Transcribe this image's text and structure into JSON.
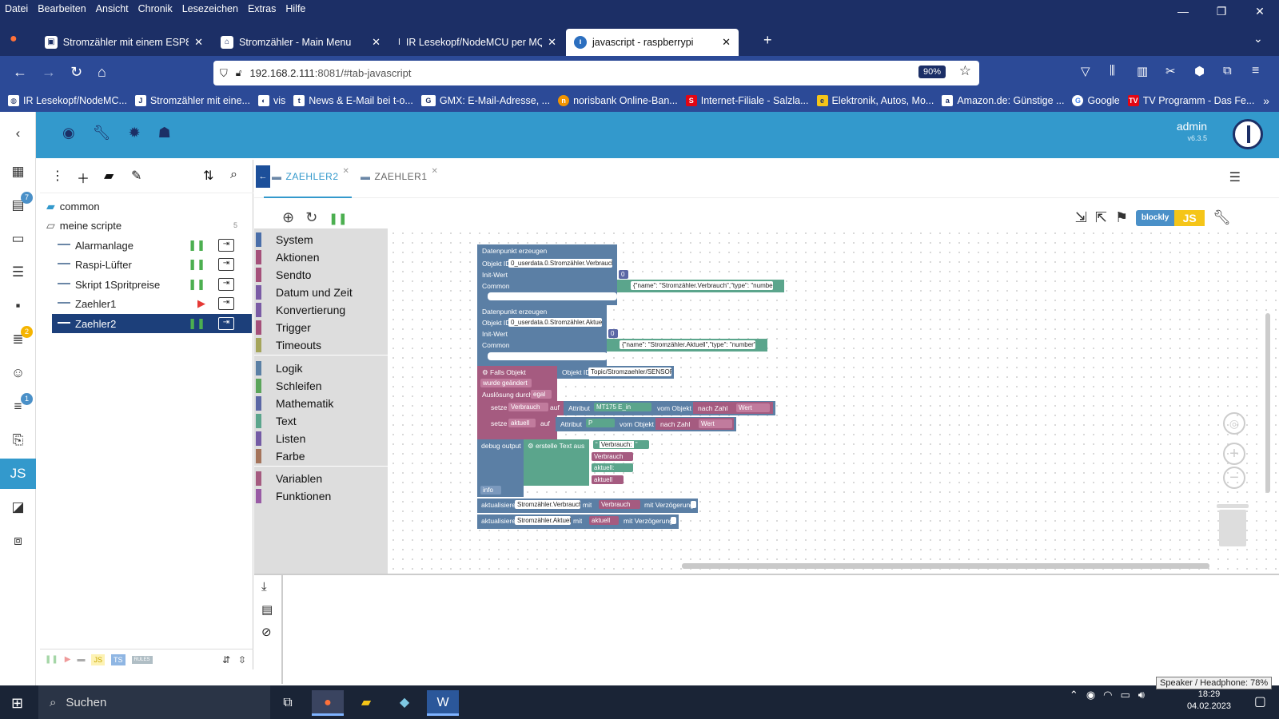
{
  "menubar": [
    "Datei",
    "Bearbeiten",
    "Ansicht",
    "Chronik",
    "Lesezeichen",
    "Extras",
    "Hilfe"
  ],
  "window_controls": [
    "—",
    "❐",
    "✕"
  ],
  "tabs": [
    {
      "title": "Stromzähler mit einem ESP8266"
    },
    {
      "title": "Stromzähler - Main Menu"
    },
    {
      "title": "IR Lesekopf/NodeMCU per MQTT"
    },
    {
      "title": "javascript - raspberrypi"
    }
  ],
  "nav": {
    "url_host": "192.168.2.111",
    "url_rest": ":8081/#tab-javascript",
    "zoom": "90%"
  },
  "bookmarks": [
    "IR Lesekopf/NodeMC...",
    "Stromzähler mit eine...",
    "vis",
    "News & E-Mail bei t-o...",
    "GMX: E-Mail-Adresse, ...",
    "norisbank Online-Ban...",
    "Internet-Filiale - Salzla...",
    "Elektronik, Autos, Mo...",
    "Amazon.de: Günstige ...",
    "Google",
    "TV Programm - Das Fe..."
  ],
  "rail_badges": {
    "hosts": "7",
    "logs": "2",
    "instances": "1"
  },
  "user": {
    "name": "admin",
    "version": "v6.3.5"
  },
  "tree": {
    "folders": [
      {
        "name": "common"
      },
      {
        "name": "meine scripte",
        "count": "5"
      }
    ],
    "scripts": [
      {
        "name": "Alarmanlage"
      },
      {
        "name": "Raspi-Lüfter"
      },
      {
        "name": "Skript 1Spritpreise"
      },
      {
        "name": "Zaehler1"
      },
      {
        "name": "Zaehler2"
      }
    ],
    "footer_tags": [
      "JS",
      "TS",
      "RULES"
    ]
  },
  "editor_tabs": [
    "ZAEHLER2",
    "ZAEHLER1"
  ],
  "blockly_toggle": {
    "left": "blockly",
    "right": "JS"
  },
  "colors": {
    "header": "#3399cc",
    "browser": "#1c2f66",
    "selected": "#1c3f7a"
  },
  "categories": [
    {
      "name": "System",
      "color": "#4a6ea9"
    },
    {
      "name": "Aktionen",
      "color": "#a5507a"
    },
    {
      "name": "Sendto",
      "color": "#a5507a"
    },
    {
      "name": "Datum und Zeit",
      "color": "#7a5ba5"
    },
    {
      "name": "Konvertierung",
      "color": "#7a5ba5"
    },
    {
      "name": "Trigger",
      "color": "#a5507a"
    },
    {
      "name": "Timeouts",
      "color": "#a5a55b"
    },
    {
      "name": "Logik",
      "color": "#5b80a5"
    },
    {
      "name": "Schleifen",
      "color": "#5ba55b"
    },
    {
      "name": "Mathematik",
      "color": "#5b67a5"
    },
    {
      "name": "Text",
      "color": "#5ba58c"
    },
    {
      "name": "Listen",
      "color": "#745ba5"
    },
    {
      "name": "Farbe",
      "color": "#a5745b"
    },
    {
      "name": "Variablen",
      "color": "#a55b80"
    },
    {
      "name": "Funktionen",
      "color": "#995ba5"
    }
  ],
  "blocks": {
    "dp1": {
      "title": "Datenpunkt erzeugen",
      "objid_label": "Objekt ID",
      "objid": "0_userdata.0.Stromzähler.Verbrauch",
      "init_label": "Init-Wert",
      "init": "0",
      "common_label": "Common",
      "common": "{\"name\": \"Stromzähler.Verbrauch\",\"type\": \"number..."
    },
    "dp2": {
      "title": "Datenpunkt erzeugen",
      "objid_label": "Objekt ID",
      "objid": "0_userdata.0.Stromzähler.Aktuell",
      "init_label": "Init-Wert",
      "init": "0",
      "common_label": "Common",
      "common": "{\"name\": \"Stromzähler.Aktuell\",\"type\": \"number\",..."
    },
    "trigger": {
      "title": "Falls Objekt",
      "objid_label": "Objekt ID",
      "objid": "Topic/Stromzaehler/SENSOR",
      "changed": "wurde geändert",
      "by": "Auslösung durch",
      "by_val": "egal"
    },
    "set1": {
      "setze": "setze",
      "var": "Verbrauch",
      "auf": "auf",
      "attr": "Attribut",
      "attr_val": "MT175 E_in",
      "from": "vom Objekt",
      "num": "nach Zahl",
      "val": "Wert"
    },
    "set2": {
      "setze": "setze",
      "var": "aktuell",
      "auf": "auf",
      "attr": "Attribut",
      "attr_val": "P",
      "from": "vom Objekt",
      "num": "nach Zahl",
      "val": "Wert"
    },
    "debug": {
      "title": "debug output",
      "text": "erstelle Text aus",
      "s1": "Verbrauch:",
      "v1": "Verbrauch",
      "s2": "aktuell:",
      "v2": "aktuell",
      "level": "info"
    },
    "upd1": {
      "title": "aktualisiere",
      "target": "Stromzähler.Verbrauch",
      "mit": "mit",
      "val": "Verbrauch",
      "delay": "mit Verzögerung"
    },
    "upd2": {
      "title": "aktualisiere",
      "target": "Stromzähler.Aktuell",
      "mit": "mit",
      "val": "aktuell",
      "delay": "mit Verzögerung"
    }
  },
  "taskbar": {
    "search": "Suchen",
    "time": "18:29",
    "date": "04.02.2023",
    "tooltip": "Speaker / Headphone: 78%"
  }
}
